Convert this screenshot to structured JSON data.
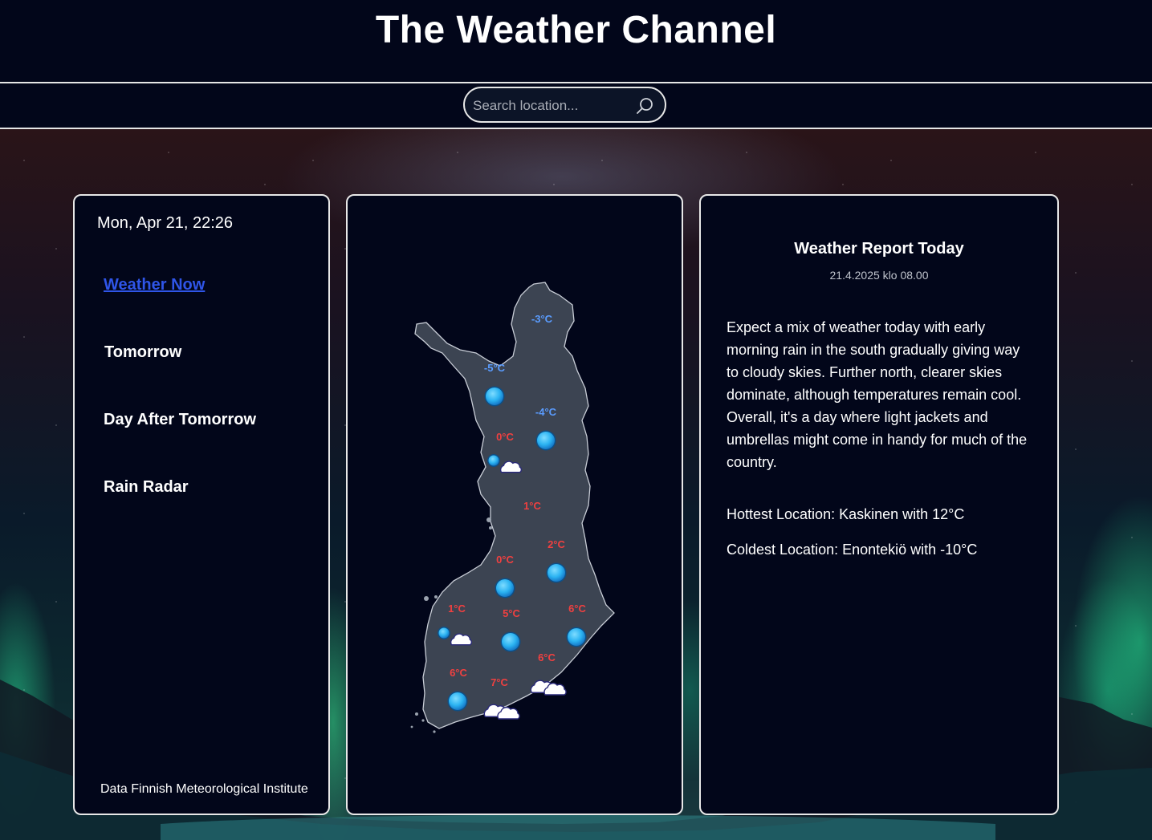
{
  "header": {
    "title": "The Weather Channel"
  },
  "search": {
    "placeholder": "Search location...",
    "icon": "search-icon"
  },
  "sidebar": {
    "datetime": "Mon, Apr 21, 22:26",
    "items": [
      {
        "label": "Weather Now",
        "active": true
      },
      {
        "label": "Tomorrow",
        "active": false
      },
      {
        "label": "Day After Tomorrow",
        "active": false
      },
      {
        "label": "Rain Radar",
        "active": false
      }
    ],
    "credit": "Data Finnish Meteorological Institute"
  },
  "map": {
    "region": "Finland",
    "colors": {
      "cold": "#5a9cff",
      "warm": "#f04040",
      "land": "#3c4452",
      "sun": "#35b8f5"
    },
    "stations": [
      {
        "temp": "-3°C",
        "cold": true,
        "icon": "none"
      },
      {
        "temp": "-5°C",
        "cold": true,
        "icon": "clear-icon"
      },
      {
        "temp": "-4°C",
        "cold": true,
        "icon": "clear-icon"
      },
      {
        "temp": "0°C",
        "cold": false,
        "icon": "partly-cloudy-icon"
      },
      {
        "temp": "1°C",
        "cold": false,
        "icon": "none"
      },
      {
        "temp": "2°C",
        "cold": false,
        "icon": "clear-icon"
      },
      {
        "temp": "0°C",
        "cold": false,
        "icon": "clear-icon"
      },
      {
        "temp": "1°C",
        "cold": false,
        "icon": "partly-cloudy-icon"
      },
      {
        "temp": "5°C",
        "cold": false,
        "icon": "clear-icon"
      },
      {
        "temp": "6°C",
        "cold": false,
        "icon": "clear-icon"
      },
      {
        "temp": "6°C",
        "cold": false,
        "icon": "cloudy-icon"
      },
      {
        "temp": "6°C",
        "cold": false,
        "icon": "clear-icon"
      },
      {
        "temp": "7°C",
        "cold": false,
        "icon": "cloudy-icon"
      }
    ]
  },
  "report": {
    "title": "Weather Report Today",
    "date": "21.4.2025 klo 08.00",
    "body": "Expect a mix of weather today with early morning rain in the south gradually giving way to cloudy skies. Further north, clearer skies dominate, although temperatures remain cool. Overall, it's a day where light jackets and umbrellas might come in handy for much of the country.",
    "hottest": "Hottest Location: Kaskinen with 12°C",
    "coldest": "Coldest Location: Enontekiö with -10°C"
  }
}
